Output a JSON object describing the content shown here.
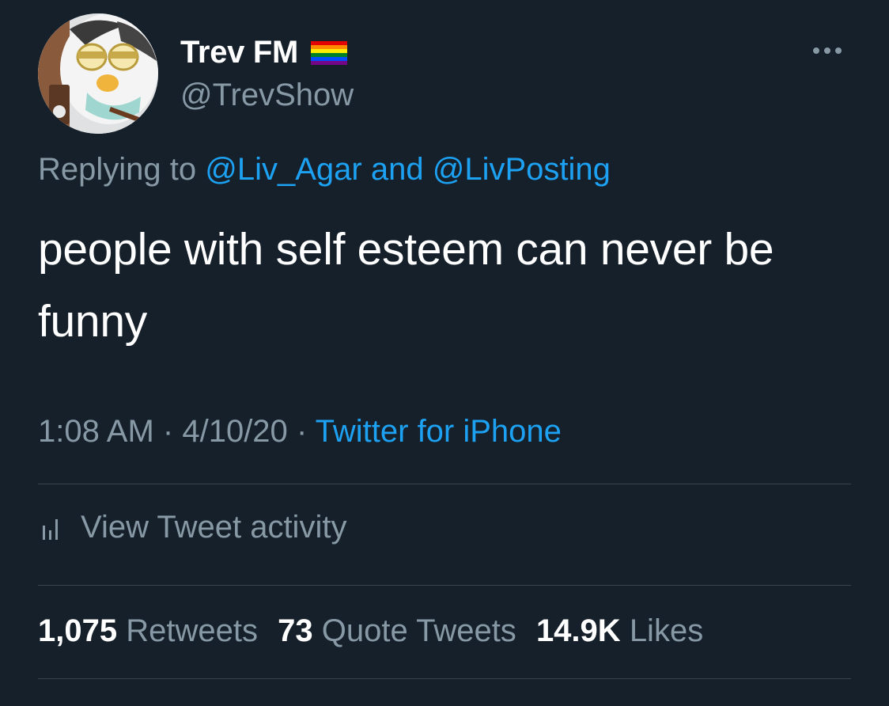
{
  "author": {
    "display_name": "Trev FM",
    "handle": "@TrevShow",
    "badge_icon": "rainbow-flag-icon",
    "avatar_icon": "furby-avatar"
  },
  "reply_context": {
    "prefix": "Replying to",
    "user1": "@Liv_Agar",
    "conjunction": "and",
    "user2": "@LivPosting"
  },
  "tweet": {
    "text": "people with self esteem can never be funny"
  },
  "meta": {
    "time": "1:08 AM",
    "separator": "·",
    "date": "4/10/20",
    "source": "Twitter for iPhone"
  },
  "activity": {
    "label": "View Tweet activity",
    "icon": "bar-chart-icon"
  },
  "stats": {
    "retweets_count": "1,075",
    "retweets_label": "Retweets",
    "quote_count": "73",
    "quote_label": "Quote Tweets",
    "likes_count": "14.9K",
    "likes_label": "Likes"
  },
  "colors": {
    "background": "#15202b",
    "primary_text": "#ffffff",
    "secondary_text": "#8899a6",
    "link": "#1da1f2",
    "divider": "#38444d"
  }
}
